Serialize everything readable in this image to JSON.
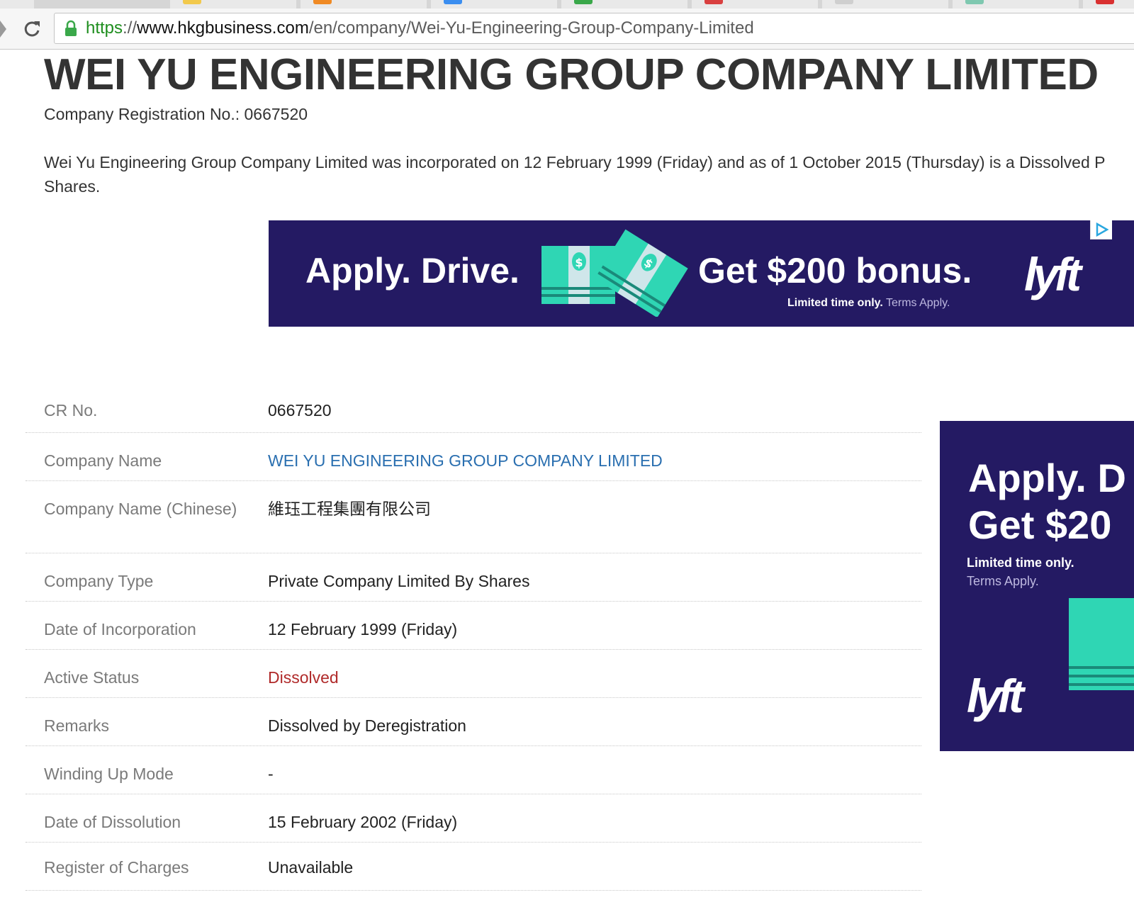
{
  "browser": {
    "url_scheme": "https",
    "url_sep": "://",
    "url_host": "www.hkgbusiness.com",
    "url_path": "/en/company/Wei-Yu-Engineering-Group-Company-Limited"
  },
  "page": {
    "title": "WEI YU ENGINEERING GROUP COMPANY LIMITED",
    "registration_line": "Company Registration No.: 0667520",
    "intro_line1": "Wei Yu Engineering Group Company Limited was incorporated on 12 February 1999 (Friday) and as of 1 October 2015 (Thursday) is a Dissolved P",
    "intro_line2": "Shares."
  },
  "ad_banner": {
    "headline": "Apply. Drive.",
    "offer": "Get $200 bonus.",
    "fine_bold": "Limited time only.",
    "fine_light": "Terms Apply.",
    "brand": "lyft"
  },
  "details": [
    {
      "label": "CR No.",
      "value": "0667520"
    },
    {
      "label": "Company Name",
      "value": "WEI YU ENGINEERING GROUP COMPANY LIMITED"
    },
    {
      "label": "Company Name (Chinese)",
      "value": "維珏工程集團有限公司"
    },
    {
      "label": "Company Type",
      "value": "Private Company Limited By Shares"
    },
    {
      "label": "Date of Incorporation",
      "value": "12 February 1999 (Friday)"
    },
    {
      "label": "Active Status",
      "value": "Dissolved"
    },
    {
      "label": "Remarks",
      "value": "Dissolved by Deregistration"
    },
    {
      "label": "Winding Up Mode",
      "value": "-"
    },
    {
      "label": "Date of Dissolution",
      "value": "15 February 2002 (Friday)"
    },
    {
      "label": "Register of Charges",
      "value": "Unavailable"
    }
  ],
  "ad_side": {
    "line1": "Apply. D",
    "line2": "Get $20",
    "fine_bold": "Limited time only.",
    "fine_light": "Terms Apply.",
    "brand": "lyft"
  },
  "colors": {
    "ad_background": "#241a63",
    "link_blue": "#2a6fb0",
    "status_red": "#b02a2a",
    "money_green": "#2fd6b4"
  },
  "icons": {
    "reload": "reload-icon",
    "lock": "lock-icon",
    "adchoices": "adchoices-icon"
  }
}
